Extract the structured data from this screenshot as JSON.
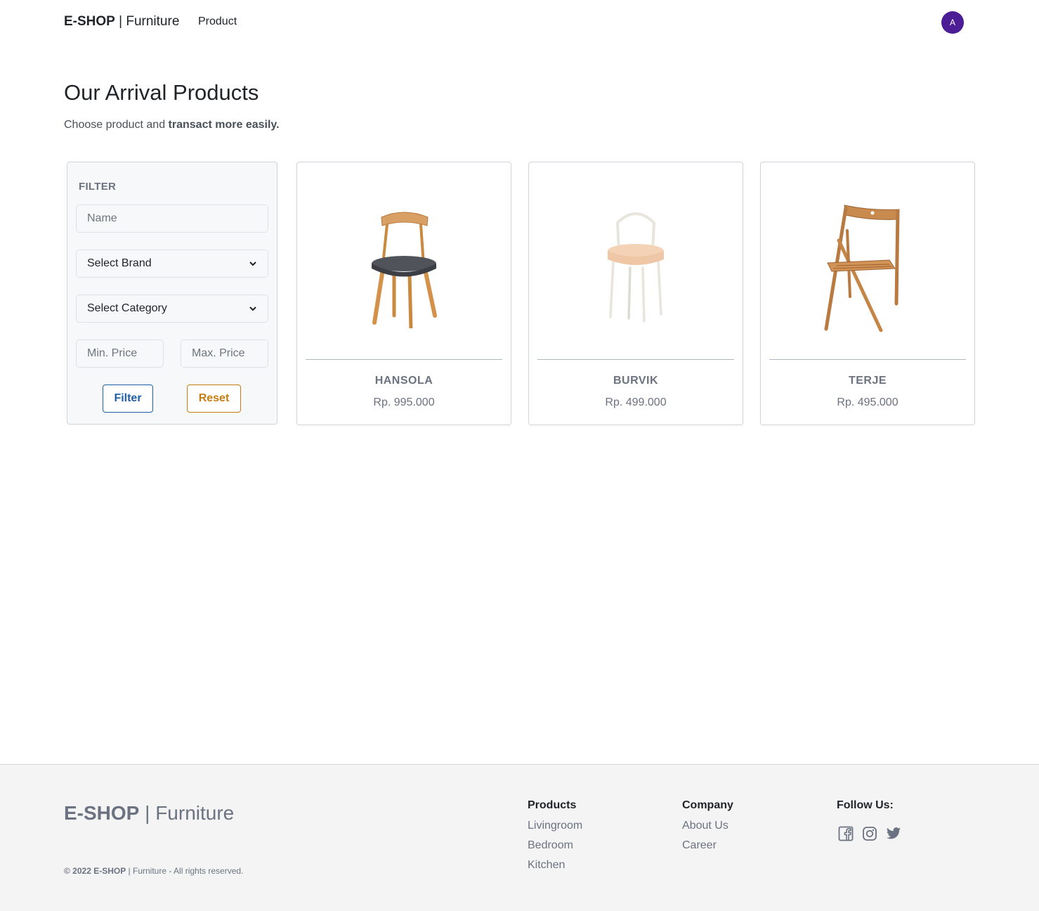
{
  "header": {
    "brand_bold": "E-SHOP",
    "brand_rest": " | Furniture",
    "nav_product": "Product",
    "avatar_initial": "A",
    "avatar_color": "#4c1d95"
  },
  "hero": {
    "title": "Our Arrival Products",
    "subtitle_plain": "Choose product and ",
    "subtitle_bold": "transact more easily."
  },
  "filter": {
    "title": "FILTER",
    "name_placeholder": "Name",
    "brand_select": "Select Brand",
    "category_select": "Select Category",
    "min_price_placeholder": "Min. Price",
    "max_price_placeholder": "Max. Price",
    "filter_button": "Filter",
    "reset_button": "Reset",
    "filter_color": "#1f5fa8",
    "reset_color": "#c77d12"
  },
  "products": [
    {
      "name": "HANSOLA",
      "price": "Rp. 995.000",
      "image": "dining-chair-image"
    },
    {
      "name": "BURVIK",
      "price": "Rp. 499.000",
      "image": "side-table-image"
    },
    {
      "name": "TERJE",
      "price": "Rp. 495.000",
      "image": "folding-chair-image"
    }
  ],
  "footer": {
    "brand_bold": "E-SHOP",
    "brand_rest": " | Furniture",
    "copyright_bold": "© 2022 E-SHOP",
    "copyright_rest": " | Furniture - All rights reserved.",
    "products_heading": "Products",
    "products_links": [
      "Livingroom",
      "Bedroom",
      "Kitchen"
    ],
    "company_heading": "Company",
    "company_links": [
      "About Us",
      "Career"
    ],
    "follow_heading": "Follow Us:",
    "socials": [
      "facebook-icon",
      "instagram-icon",
      "twitter-icon"
    ]
  }
}
